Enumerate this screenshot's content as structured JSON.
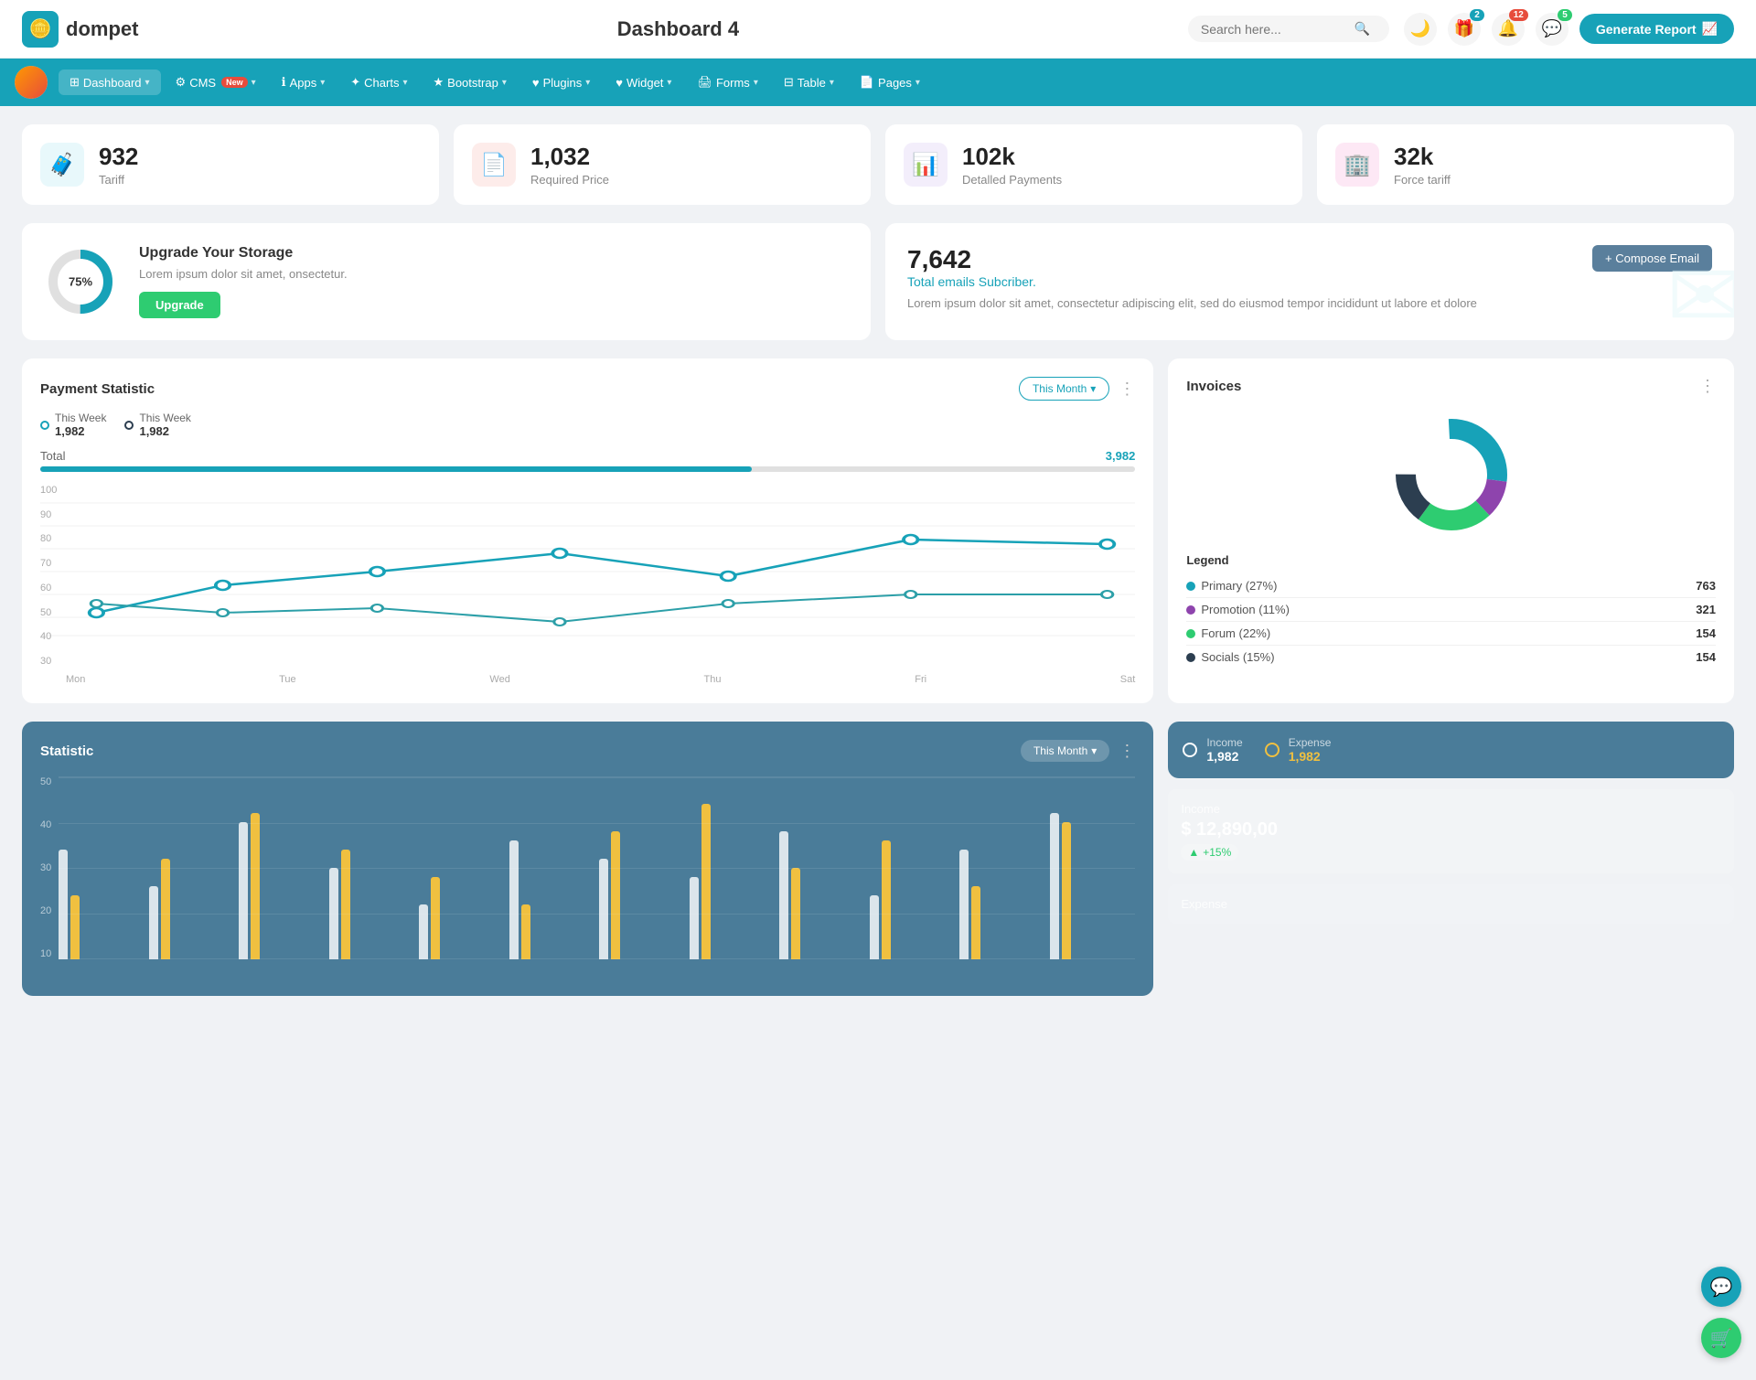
{
  "header": {
    "logo_text": "dompet",
    "page_title": "Dashboard 4",
    "search_placeholder": "Search here...",
    "generate_button": "Generate Report",
    "badges": {
      "gift": "2",
      "bell": "12",
      "chat": "5"
    }
  },
  "navbar": {
    "items": [
      {
        "id": "dashboard",
        "label": "Dashboard",
        "active": true,
        "has_chevron": true
      },
      {
        "id": "cms",
        "label": "CMS",
        "active": false,
        "has_chevron": true,
        "is_new": true
      },
      {
        "id": "apps",
        "label": "Apps",
        "active": false,
        "has_chevron": true
      },
      {
        "id": "charts",
        "label": "Charts",
        "active": false,
        "has_chevron": true
      },
      {
        "id": "bootstrap",
        "label": "Bootstrap",
        "active": false,
        "has_chevron": true
      },
      {
        "id": "plugins",
        "label": "Plugins",
        "active": false,
        "has_chevron": true
      },
      {
        "id": "widget",
        "label": "Widget",
        "active": false,
        "has_chevron": true
      },
      {
        "id": "forms",
        "label": "Forms",
        "active": false,
        "has_chevron": true
      },
      {
        "id": "table",
        "label": "Table",
        "active": false,
        "has_chevron": true
      },
      {
        "id": "pages",
        "label": "Pages",
        "active": false,
        "has_chevron": true
      }
    ]
  },
  "stat_cards": [
    {
      "id": "tariff",
      "value": "932",
      "label": "Tariff",
      "icon": "🧳",
      "icon_type": "blue"
    },
    {
      "id": "required_price",
      "value": "1,032",
      "label": "Required Price",
      "icon": "📄",
      "icon_type": "red"
    },
    {
      "id": "detailed_payments",
      "value": "102k",
      "label": "Detalled Payments",
      "icon": "📊",
      "icon_type": "purple"
    },
    {
      "id": "force_tariff",
      "value": "32k",
      "label": "Force tariff",
      "icon": "🏢",
      "icon_type": "pink"
    }
  ],
  "storage": {
    "percent": 75,
    "percent_label": "75%",
    "title": "Upgrade Your Storage",
    "description": "Lorem ipsum dolor sit amet, onsectetur.",
    "button_label": "Upgrade"
  },
  "email": {
    "count": "7,642",
    "subtitle": "Total emails Subcriber.",
    "description": "Lorem ipsum dolor sit amet, consectetur adipiscing elit, sed do eiusmod tempor incididunt ut labore et dolore",
    "compose_button": "+ Compose Email"
  },
  "payment": {
    "title": "Payment Statistic",
    "filter_label": "This Month",
    "legend1_label": "This Week",
    "legend1_value": "1,982",
    "legend2_label": "This Week",
    "legend2_value": "1,982",
    "total_label": "Total",
    "total_value": "3,982",
    "progress_percent": 65,
    "y_axis": [
      "100",
      "90",
      "80",
      "70",
      "60",
      "50",
      "40",
      "30"
    ],
    "x_axis": [
      "Mon",
      "Tue",
      "Wed",
      "Thu",
      "Fri",
      "Sat"
    ],
    "line1_points": "40,160 130,130 240,115 370,95 490,120 620,80 760,85",
    "line2_points": "40,130 130,140 240,135 370,150 490,130 620,120 760,120"
  },
  "invoices": {
    "title": "Invoices",
    "legend": [
      {
        "label": "Primary (27%)",
        "color": "#17a2b8",
        "value": "763"
      },
      {
        "label": "Promotion (11%)",
        "color": "#8e44ad",
        "value": "321"
      },
      {
        "label": "Forum (22%)",
        "color": "#2ecc71",
        "value": "154"
      },
      {
        "label": "Socials (15%)",
        "color": "#2c3e50",
        "value": "154"
      }
    ]
  },
  "statistic": {
    "title": "Statistic",
    "filter_label": "This Month",
    "income_label": "Income",
    "income_value": "1,982",
    "expense_label": "Expense",
    "expense_value": "1,982",
    "income_amount": "$ 12,890,00",
    "income_change": "+15%",
    "expense_section_label": "Expense",
    "bars": [
      {
        "white": 60,
        "yellow": 35
      },
      {
        "white": 40,
        "yellow": 55
      },
      {
        "white": 75,
        "yellow": 80
      },
      {
        "white": 50,
        "yellow": 60
      },
      {
        "white": 30,
        "yellow": 45
      },
      {
        "white": 65,
        "yellow": 30
      },
      {
        "white": 55,
        "yellow": 70
      },
      {
        "white": 45,
        "yellow": 85
      },
      {
        "white": 70,
        "yellow": 50
      },
      {
        "white": 35,
        "yellow": 65
      },
      {
        "white": 60,
        "yellow": 40
      },
      {
        "white": 80,
        "yellow": 75
      }
    ],
    "y_axis": [
      "50",
      "40",
      "30",
      "20",
      "10"
    ]
  },
  "fabs": {
    "support_icon": "💬",
    "cart_icon": "🛒"
  }
}
